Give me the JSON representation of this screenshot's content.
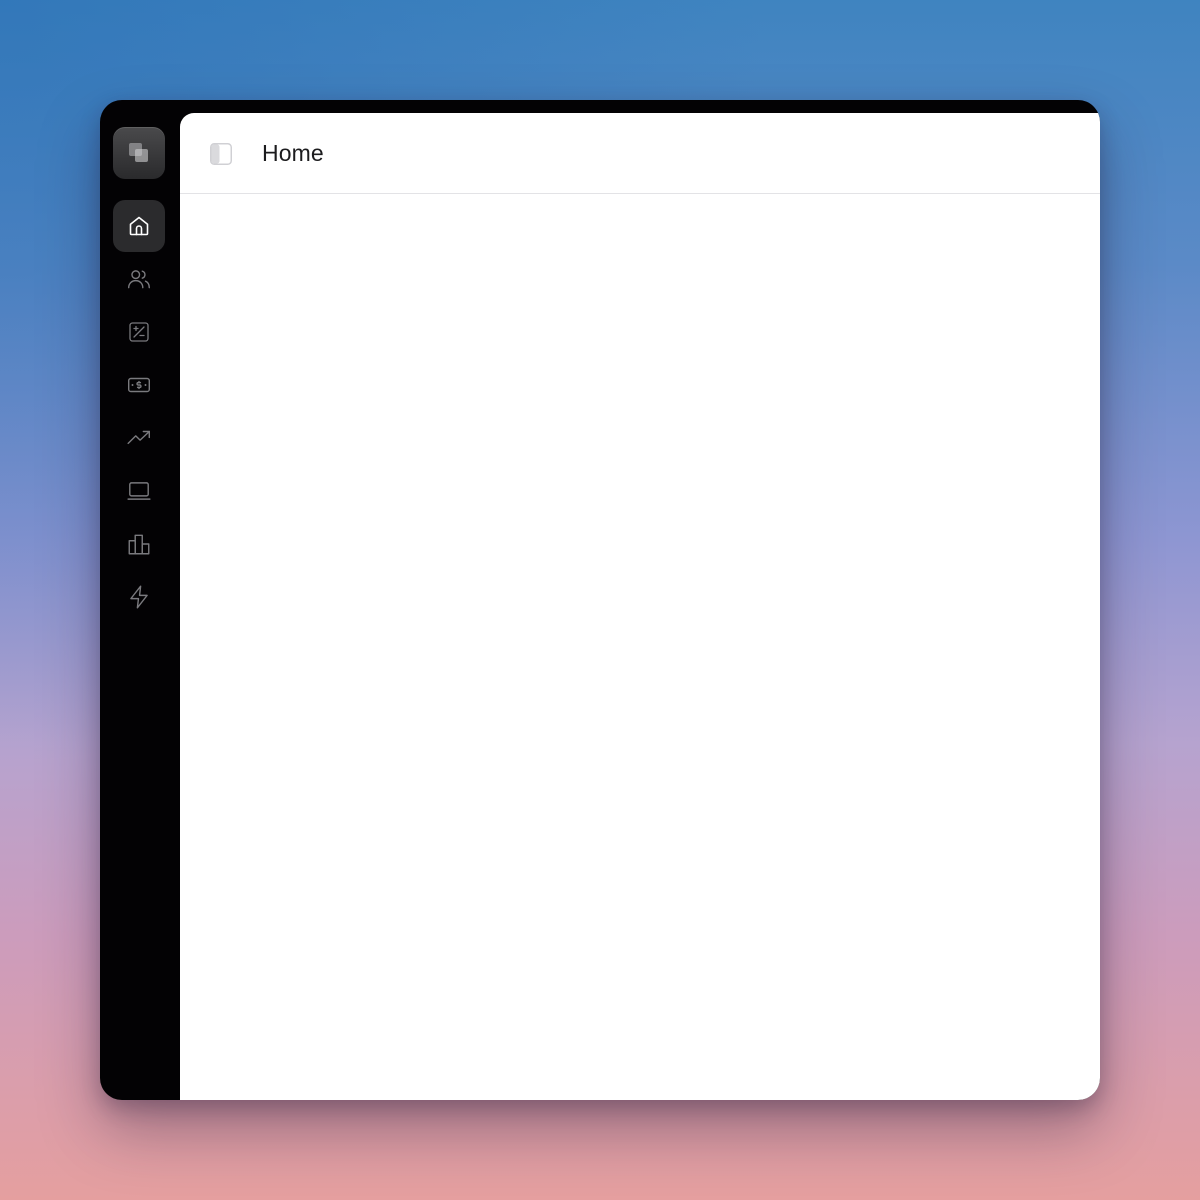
{
  "header": {
    "title": "Home",
    "toggle_icon": "sidebar-toggle-icon"
  },
  "sidebar": {
    "logo_icon": "app-logo-icon",
    "items": [
      {
        "name": "home",
        "icon": "home-icon",
        "active": true
      },
      {
        "name": "users",
        "icon": "users-icon",
        "active": false
      },
      {
        "name": "calculations",
        "icon": "plus-minus-icon",
        "active": false
      },
      {
        "name": "billing",
        "icon": "banknote-icon",
        "active": false
      },
      {
        "name": "trends",
        "icon": "trending-up-icon",
        "active": false
      },
      {
        "name": "devices",
        "icon": "laptop-icon",
        "active": false
      },
      {
        "name": "buildings",
        "icon": "buildings-icon",
        "active": false
      },
      {
        "name": "activity",
        "icon": "zap-icon",
        "active": false
      }
    ]
  },
  "colors": {
    "sidebar_bg": "#030204",
    "active_item_bg": "#2b2b2d",
    "icon_active": "#ffffff",
    "icon_inactive": "#7a7a7e",
    "content_bg": "#ffffff",
    "title_text": "#1c1c1e"
  }
}
